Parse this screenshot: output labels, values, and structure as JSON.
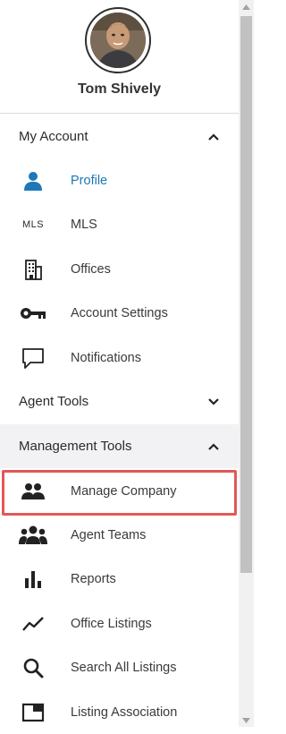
{
  "user": {
    "name": "Tom Shively"
  },
  "sections": {
    "my_account": {
      "label": "My Account",
      "chevron": "chevron-up-icon"
    },
    "agent_tools": {
      "label": "Agent Tools",
      "chevron": "chevron-down-icon"
    },
    "management_tools": {
      "label": "Management Tools",
      "chevron": "chevron-up-icon"
    }
  },
  "my_account_items": [
    {
      "label": "Profile",
      "icon": "person-icon",
      "active": true
    },
    {
      "label": "MLS",
      "icon_text": "MLS",
      "icon": "mls-text-icon"
    },
    {
      "label": "Offices",
      "icon": "building-icon"
    },
    {
      "label": "Account Settings",
      "icon": "key-icon"
    },
    {
      "label": "Notifications",
      "icon": "speech-bubble-icon"
    }
  ],
  "management_items": [
    {
      "label": "Manage Company",
      "icon": "people-icon",
      "highlighted": true
    },
    {
      "label": "Agent Teams",
      "icon": "team-icon"
    },
    {
      "label": "Reports",
      "icon": "bar-chart-icon"
    },
    {
      "label": "Office Listings",
      "icon": "trend-line-icon"
    },
    {
      "label": "Search All Listings",
      "icon": "magnifier-icon"
    },
    {
      "label": "Listing Association",
      "icon": "window-icon"
    }
  ],
  "colors": {
    "active": "#1d77b8",
    "highlight_border": "#e25856",
    "shaded_section": "#f2f2f4"
  }
}
